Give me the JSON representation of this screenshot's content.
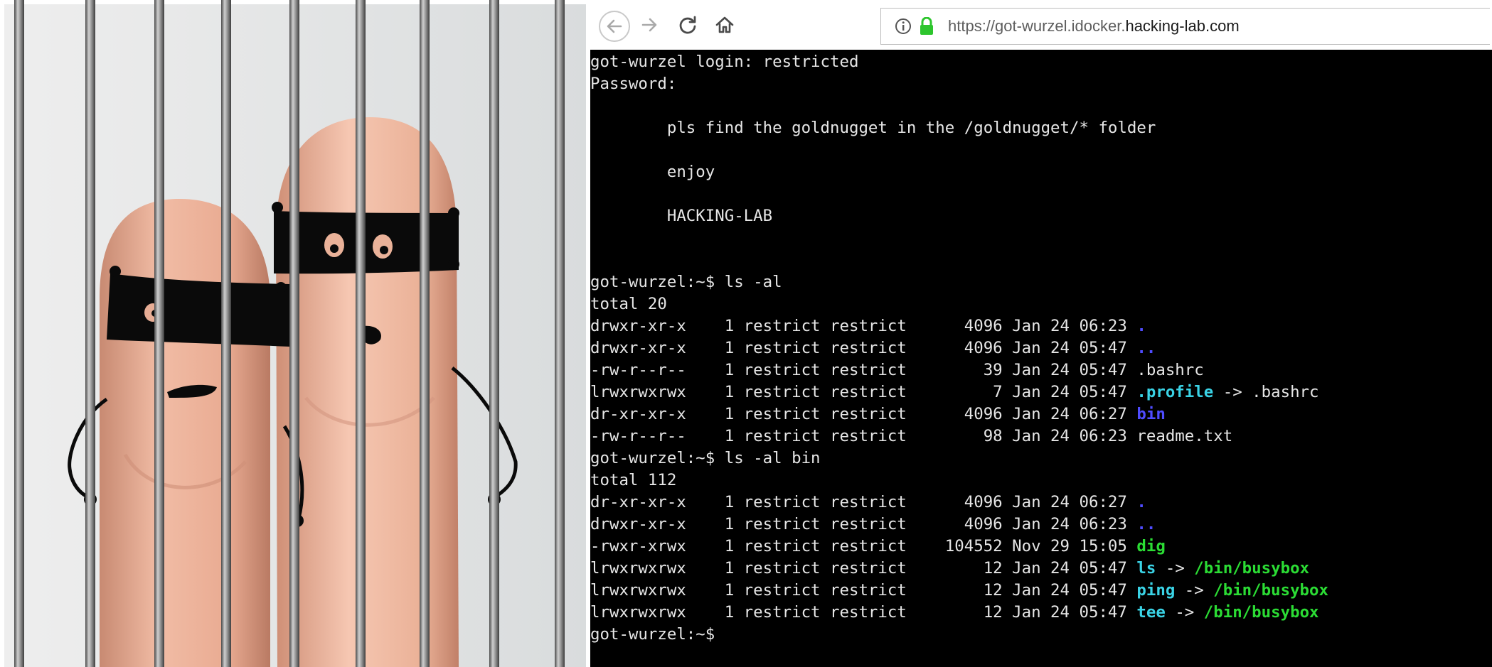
{
  "browser": {
    "url_prefix": "https://got-wurzel.idocker.",
    "url_host": "hacking-lab.com"
  },
  "icons": {
    "back": "arrow-left-icon",
    "forward": "arrow-right-icon",
    "reload": "reload-icon",
    "home": "home-icon",
    "info": "info-icon",
    "lock": "lock-icon"
  },
  "colors": {
    "terminal_bg": "#000000",
    "terminal_fg": "#e6e6e6",
    "dir_blue": "#4f4cff",
    "link_cyan": "#3ad3e6",
    "exec_green": "#2bdc34",
    "lock_green": "#2dc52d"
  },
  "terminal": {
    "lines": [
      {
        "segments": [
          {
            "text": "got-wurzel login: restricted",
            "c": "plain"
          }
        ]
      },
      {
        "segments": [
          {
            "text": "Password:",
            "c": "plain"
          }
        ]
      },
      {
        "segments": [
          {
            "text": "",
            "c": "plain"
          }
        ]
      },
      {
        "segments": [
          {
            "text": "        pls find the goldnugget in the /goldnugget/* folder",
            "c": "plain"
          }
        ]
      },
      {
        "segments": [
          {
            "text": "",
            "c": "plain"
          }
        ]
      },
      {
        "segments": [
          {
            "text": "        enjoy",
            "c": "plain"
          }
        ]
      },
      {
        "segments": [
          {
            "text": "",
            "c": "plain"
          }
        ]
      },
      {
        "segments": [
          {
            "text": "        HACKING-LAB",
            "c": "plain"
          }
        ]
      },
      {
        "segments": [
          {
            "text": "",
            "c": "plain"
          }
        ]
      },
      {
        "segments": [
          {
            "text": "",
            "c": "plain"
          }
        ]
      },
      {
        "segments": [
          {
            "text": "got-wurzel:~$ ls -al",
            "c": "plain"
          }
        ]
      },
      {
        "segments": [
          {
            "text": "total 20",
            "c": "plain"
          }
        ]
      },
      {
        "segments": [
          {
            "text": "drwxr-xr-x    1 restrict restrict      4096 Jan 24 06:23 ",
            "c": "plain"
          },
          {
            "text": ".",
            "c": "blue"
          }
        ]
      },
      {
        "segments": [
          {
            "text": "drwxr-xr-x    1 restrict restrict      4096 Jan 24 05:47 ",
            "c": "plain"
          },
          {
            "text": "..",
            "c": "blue"
          }
        ]
      },
      {
        "segments": [
          {
            "text": "-rw-r--r--    1 restrict restrict        39 Jan 24 05:47 .bashrc",
            "c": "plain"
          }
        ]
      },
      {
        "segments": [
          {
            "text": "lrwxrwxrwx    1 restrict restrict         7 Jan 24 05:47 ",
            "c": "plain"
          },
          {
            "text": ".profile",
            "c": "cyan"
          },
          {
            "text": " -> .bashrc",
            "c": "plain"
          }
        ]
      },
      {
        "segments": [
          {
            "text": "dr-xr-xr-x    1 restrict restrict      4096 Jan 24 06:27 ",
            "c": "plain"
          },
          {
            "text": "bin",
            "c": "blue"
          }
        ]
      },
      {
        "segments": [
          {
            "text": "-rw-r--r--    1 restrict restrict        98 Jan 24 06:23 readme.txt",
            "c": "plain"
          }
        ]
      },
      {
        "segments": [
          {
            "text": "got-wurzel:~$ ls -al bin",
            "c": "plain"
          }
        ]
      },
      {
        "segments": [
          {
            "text": "total 112",
            "c": "plain"
          }
        ]
      },
      {
        "segments": [
          {
            "text": "dr-xr-xr-x    1 restrict restrict      4096 Jan 24 06:27 ",
            "c": "plain"
          },
          {
            "text": ".",
            "c": "blue"
          }
        ]
      },
      {
        "segments": [
          {
            "text": "drwxr-xr-x    1 restrict restrict      4096 Jan 24 06:23 ",
            "c": "plain"
          },
          {
            "text": "..",
            "c": "blue"
          }
        ]
      },
      {
        "segments": [
          {
            "text": "-rwxr-xrwx    1 restrict restrict    104552 Nov 29 15:05 ",
            "c": "plain"
          },
          {
            "text": "dig",
            "c": "green"
          }
        ]
      },
      {
        "segments": [
          {
            "text": "lrwxrwxrwx    1 restrict restrict        12 Jan 24 05:47 ",
            "c": "plain"
          },
          {
            "text": "ls",
            "c": "cyan"
          },
          {
            "text": " -> ",
            "c": "plain"
          },
          {
            "text": "/bin/busybox",
            "c": "green"
          }
        ]
      },
      {
        "segments": [
          {
            "text": "lrwxrwxrwx    1 restrict restrict        12 Jan 24 05:47 ",
            "c": "plain"
          },
          {
            "text": "ping",
            "c": "cyan"
          },
          {
            "text": " -> ",
            "c": "plain"
          },
          {
            "text": "/bin/busybox",
            "c": "green"
          }
        ]
      },
      {
        "segments": [
          {
            "text": "lrwxrwxrwx    1 restrict restrict        12 Jan 24 05:47 ",
            "c": "plain"
          },
          {
            "text": "tee",
            "c": "cyan"
          },
          {
            "text": " -> ",
            "c": "plain"
          },
          {
            "text": "/bin/busybox",
            "c": "green"
          }
        ]
      },
      {
        "segments": [
          {
            "text": "got-wurzel:~$",
            "c": "plain"
          }
        ]
      }
    ]
  }
}
